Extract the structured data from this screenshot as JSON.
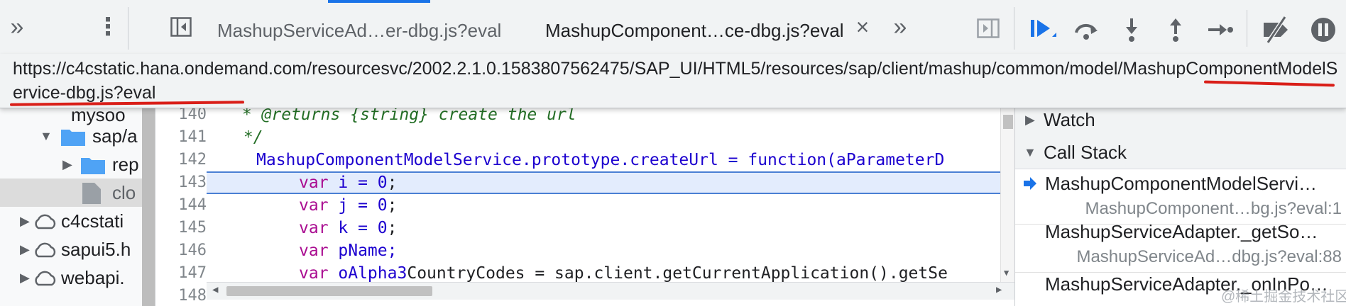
{
  "toolbar": {
    "more_tabs_glyph": "»",
    "menu_glyph": "⋮",
    "tabs": [
      {
        "label": "MashupServiceAd…er-dbg.js?eval"
      },
      {
        "label": "MashupComponent…ce-dbg.js?eval",
        "close": "×"
      }
    ],
    "overflow_glyph": "»"
  },
  "tooltip": {
    "url": "https://c4cstatic.hana.ondemand.com/resourcesvc/2002.2.1.0.1583807562475/SAP_UI/HTML5/resources/sap/client/mashup/common/model/MashupComponentModelService-dbg.js?eval"
  },
  "navigator": {
    "items": [
      {
        "label": "mysoo"
      },
      {
        "label": "sap/a"
      },
      {
        "label": "rep"
      },
      {
        "label": "clo"
      },
      {
        "label": "c4cstati"
      },
      {
        "label": "sapui5.h"
      },
      {
        "label": "webapi."
      }
    ]
  },
  "editor": {
    "lines": [
      {
        "num": "140",
        "text": " * @returns {string} create the url"
      },
      {
        "num": "141",
        "text": " */"
      },
      {
        "num": "142",
        "text": "MashupComponentModelService.prototype.createUrl = function(aParameterD"
      },
      {
        "num": "143",
        "text": "var i = 0;"
      },
      {
        "num": "144",
        "text": "var j = 0;"
      },
      {
        "num": "145",
        "text": "var k = 0;"
      },
      {
        "num": "146",
        "text": "var pName;"
      },
      {
        "num": "147",
        "text": "var oAlpha3CountryCodes = sap.client.getCurrentApplication().getSe"
      },
      {
        "num": "148",
        "text": ""
      }
    ]
  },
  "sidebar": {
    "watch_label": "Watch",
    "callstack_label": "Call Stack",
    "frames": [
      {
        "name": "MashupComponentModelServi…",
        "location": "MashupComponent…bg.js?eval:1"
      },
      {
        "name": "MashupServiceAdapter._getSo…",
        "location": "MashupServiceAd…dbg.js?eval:88"
      },
      {
        "name": "MashupServiceAdapter._onInPo…",
        "location": ""
      }
    ]
  },
  "watermark": "@稀土掘金技术社区",
  "colors": {
    "accent": "#1a73e8",
    "annotation_underline": "#d91e18",
    "keyword": "#aa0d91",
    "number": "#1c00cf",
    "comment": "#236e25"
  }
}
